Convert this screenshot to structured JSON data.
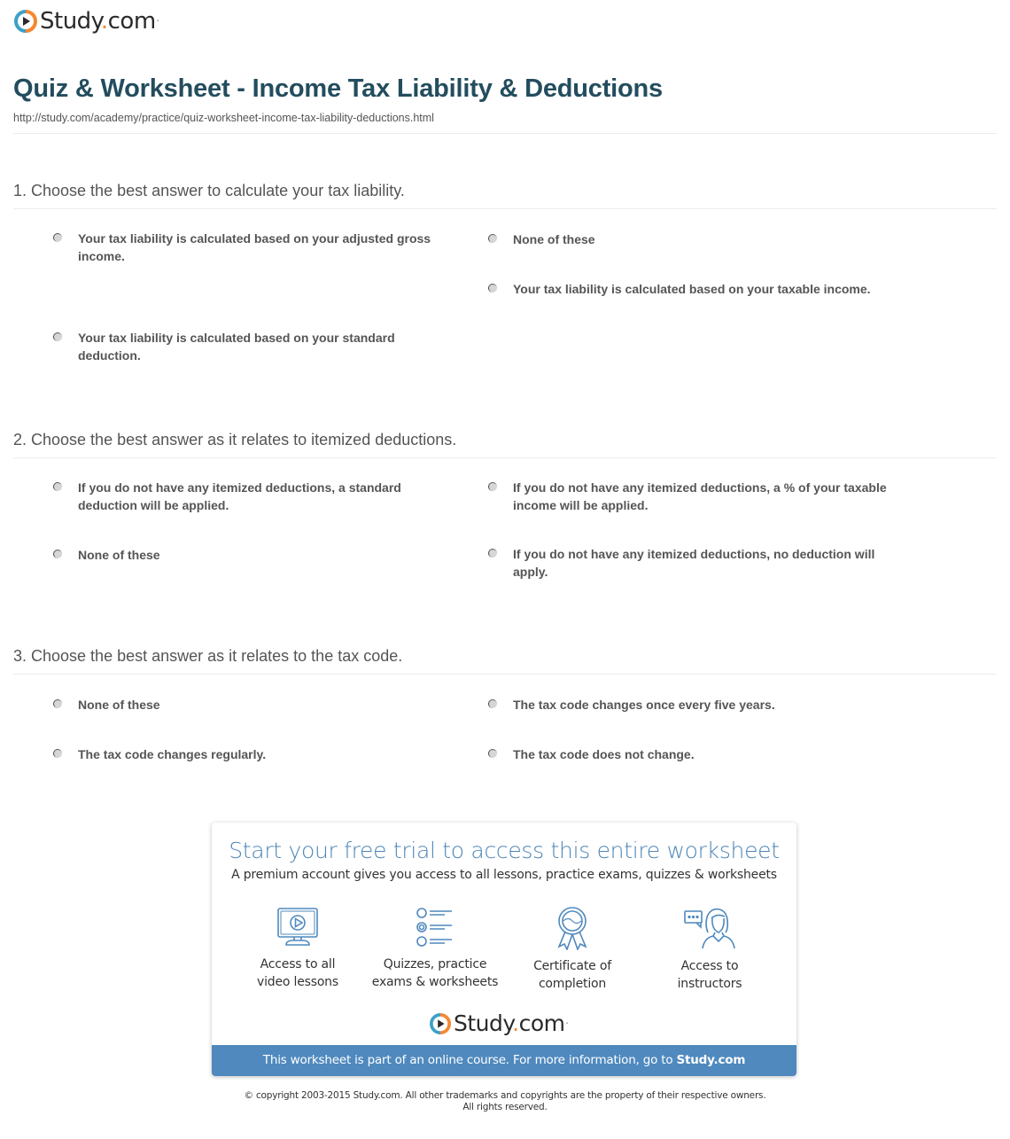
{
  "brand": {
    "name_main": "Study",
    "name_dot": ".",
    "name_tld": "com",
    "colors": {
      "ring_blue": "#3ea0c8",
      "ring_orange": "#f5872f",
      "title": "#234d5e",
      "accent_blue": "#4f89be"
    }
  },
  "header": {
    "title": "Quiz & Worksheet - Income Tax Liability & Deductions",
    "url": "http://study.com/academy/practice/quiz-worksheet-income-tax-liability-deductions.html"
  },
  "questions": [
    {
      "text": "1. Choose the best answer to calculate your tax liability.",
      "options": [
        "Your tax liability is calculated based on your adjusted gross income.",
        "None of these",
        "Your tax liability is calculated based on your taxable income.",
        "Your tax liability is calculated based on your standard deduction."
      ]
    },
    {
      "text": "2. Choose the best answer as it relates to itemized deductions.",
      "options": [
        "If you do not have any itemized deductions, a standard deduction will be applied.",
        "If you do not have any itemized deductions, a % of your taxable income will be applied.",
        "None of these",
        "If you do not have any itemized deductions, no deduction will apply."
      ]
    },
    {
      "text": "3. Choose the best answer as it relates to the tax code.",
      "options": [
        "None of these",
        "The tax code changes once every five years.",
        "The tax code changes regularly.",
        "The tax code does not change."
      ]
    }
  ],
  "promo": {
    "title": "Start your free trial to access this entire worksheet",
    "subtitle": "A premium account gives you access to all lessons, practice exams, quizzes & worksheets",
    "features": [
      {
        "icon": "video-lesson-icon",
        "line1": "Access to all",
        "line2": "video lessons"
      },
      {
        "icon": "quiz-list-icon",
        "line1": "Quizzes, practice",
        "line2": "exams & worksheets"
      },
      {
        "icon": "certificate-ribbon-icon",
        "line1": "Certificate of",
        "line2": "completion"
      },
      {
        "icon": "instructor-chat-icon",
        "line1": "Access to",
        "line2": "instructors"
      }
    ],
    "footer_text": "This worksheet is part of an online course. For more information, go to ",
    "footer_link": "Study.com"
  },
  "copyright": {
    "line1": "© copyright 2003-2015 Study.com. All other trademarks and copyrights are the property of their respective owners.",
    "line2": "All rights reserved."
  }
}
